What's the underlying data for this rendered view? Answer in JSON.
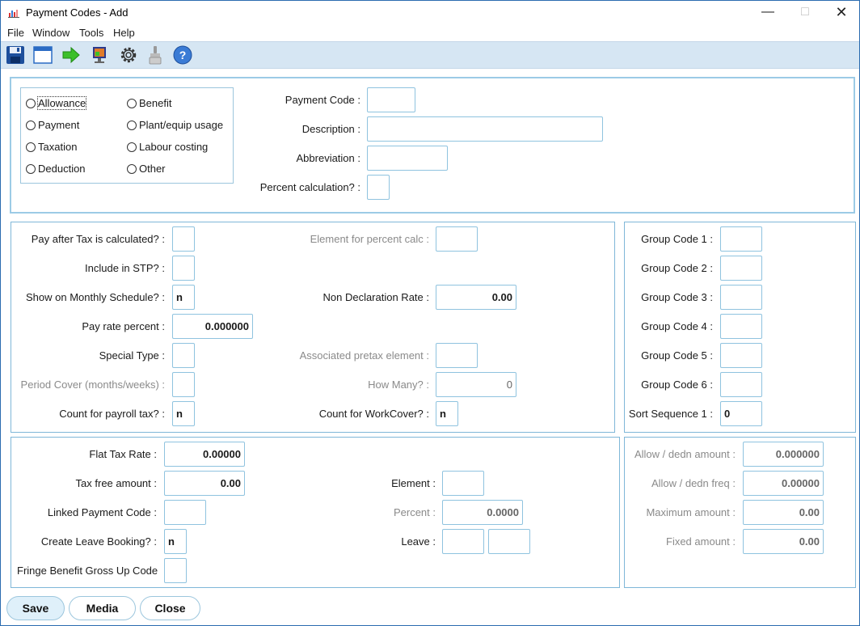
{
  "window": {
    "title": "Payment Codes - Add"
  },
  "menu": [
    "File",
    "Window",
    "Tools",
    "Help"
  ],
  "toolbar": {
    "icons": [
      "save-icon",
      "window-icon",
      "arrow-right-icon",
      "monitor-icon",
      "gear-icon",
      "brush-icon",
      "help-icon"
    ]
  },
  "type_options": {
    "allowance": "Allowance",
    "benefit": "Benefit",
    "payment": "Payment",
    "plant": "Plant/equip usage",
    "taxation": "Taxation",
    "labour": "Labour costing",
    "deduction": "Deduction",
    "other": "Other"
  },
  "header_fields": {
    "payment_code": {
      "label": "Payment Code :",
      "value": ""
    },
    "description": {
      "label": "Description :",
      "value": ""
    },
    "abbreviation": {
      "label": "Abbreviation :",
      "value": ""
    },
    "percent_calc": {
      "label": "Percent calculation? :",
      "value": ""
    }
  },
  "middle": {
    "pay_after_tax": {
      "label": "Pay after Tax is calculated? :",
      "value": ""
    },
    "include_stp": {
      "label": "Include in STP? :",
      "value": ""
    },
    "show_monthly": {
      "label": "Show on Monthly Schedule? :",
      "value": "n"
    },
    "pay_rate_percent": {
      "label": "Pay rate percent :",
      "value": "0.000000"
    },
    "special_type": {
      "label": "Special Type :",
      "value": ""
    },
    "period_cover": {
      "label": "Period Cover (months/weeks) :",
      "value": ""
    },
    "count_payroll_tax": {
      "label": "Count for payroll tax? :",
      "value": "n"
    },
    "element_percent_calc": {
      "label": "Element for percent calc :",
      "value": ""
    },
    "non_declaration_rate": {
      "label": "Non Declaration Rate :",
      "value": "0.00"
    },
    "associated_pretax": {
      "label": "Associated pretax element :",
      "value": ""
    },
    "how_many": {
      "label": "How Many? :",
      "value": "0"
    },
    "count_workcover": {
      "label": "Count for WorkCover? :",
      "value": "n"
    }
  },
  "groups": {
    "g1": {
      "label": "Group Code 1 :",
      "value": ""
    },
    "g2": {
      "label": "Group Code 2 :",
      "value": ""
    },
    "g3": {
      "label": "Group Code 3 :",
      "value": ""
    },
    "g4": {
      "label": "Group Code 4 :",
      "value": ""
    },
    "g5": {
      "label": "Group Code 5 :",
      "value": ""
    },
    "g6": {
      "label": "Group Code 6 :",
      "value": ""
    },
    "sort1": {
      "label": "Sort Sequence 1 :",
      "value": "0"
    }
  },
  "bottom": {
    "flat_tax_rate": {
      "label": "Flat Tax Rate :",
      "value": "0.00000"
    },
    "tax_free_amount": {
      "label": "Tax free amount :",
      "value": "0.00"
    },
    "linked_payment_code": {
      "label": "Linked Payment Code :",
      "value": ""
    },
    "create_leave_booking": {
      "label": "Create Leave Booking? :",
      "value": "n"
    },
    "fringe_benefit": {
      "label": "Fringe Benefit Gross Up Code",
      "value": ""
    },
    "element": {
      "label": "Element :",
      "value": ""
    },
    "percent": {
      "label": "Percent :",
      "value": "0.0000"
    },
    "leave": {
      "label": "Leave :",
      "value1": "",
      "value2": ""
    }
  },
  "allow": {
    "amount": {
      "label": "Allow / dedn amount :",
      "value": "0.000000"
    },
    "freq": {
      "label": "Allow / dedn freq :",
      "value": "0.00000"
    },
    "max": {
      "label": "Maximum amount :",
      "value": "0.00"
    },
    "fixed": {
      "label": "Fixed amount :",
      "value": "0.00"
    }
  },
  "buttons": {
    "save": "Save",
    "media": "Media",
    "close": "Close"
  }
}
